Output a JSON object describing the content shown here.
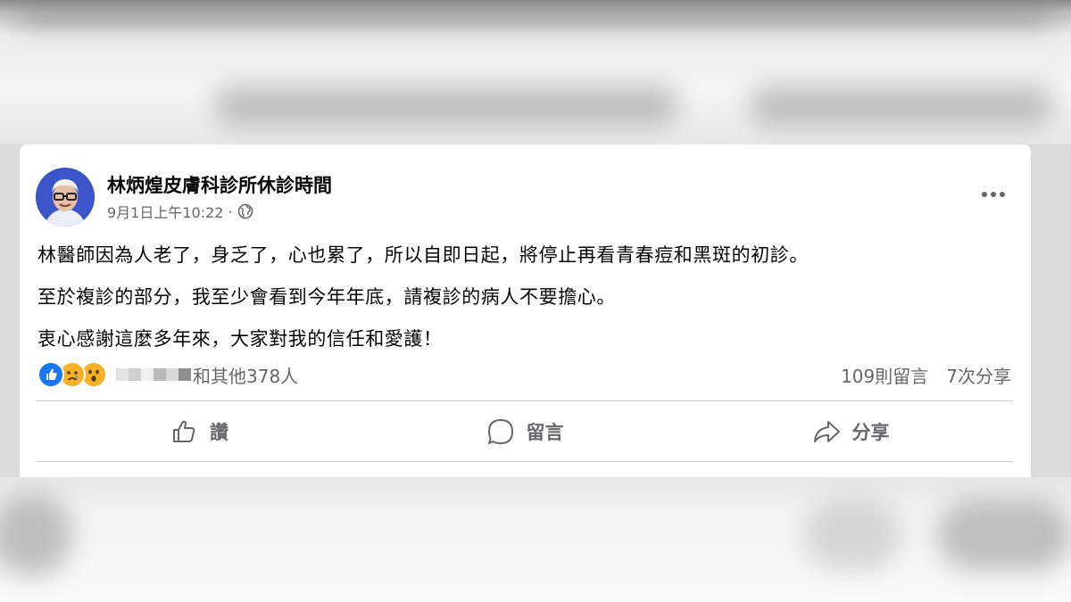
{
  "post": {
    "page_name": "林炳煌皮膚科診所休診時間",
    "timestamp": "9月1日上午10:22",
    "separator": "·",
    "lines": [
      "林醫師因為人老了，身乏了，心也累了，所以自即日起，將停止再看青春痘和黑斑的初診。",
      "至於複診的部分，我至少會看到今年年底，請複診的病人不要擔心。",
      "衷心感謝這麼多年來，大家對我的信任和愛護！"
    ]
  },
  "reactions": {
    "icons": [
      "like-icon",
      "sad-icon",
      "wow-icon"
    ],
    "summary": "和其他378人"
  },
  "stats": {
    "comments": "109則留言",
    "shares": "7次分享"
  },
  "actions": {
    "like_label": "讚",
    "comment_label": "留言",
    "share_label": "分享"
  },
  "colors": {
    "like_blue": "#1877f2",
    "emoji_yellow": "#f7b125",
    "secondary_text": "#65676b",
    "avatar_bg": "#3b55c9"
  }
}
